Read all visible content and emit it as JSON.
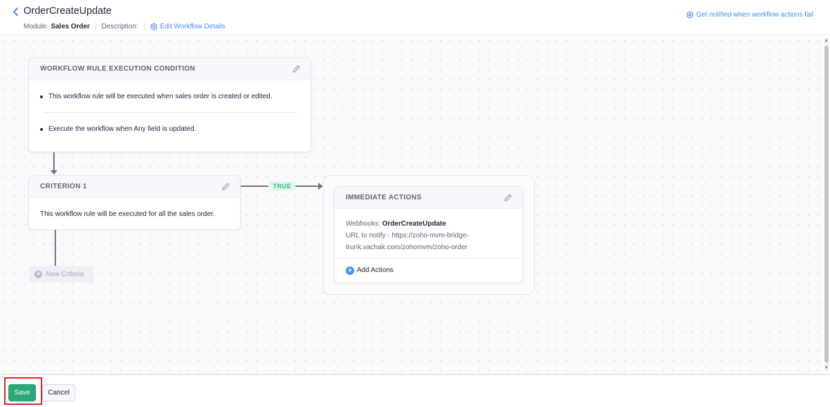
{
  "header": {
    "title": "OrderCreateUpdate",
    "module_label": "Module:",
    "module_value": "Sales Order",
    "description_label": "Description:",
    "edit_link": "Edit Workflow Details",
    "notify_link": "Get notified when workflow actions fail"
  },
  "condition_card": {
    "title": "WORKFLOW RULE EXECUTION CONDITION",
    "bullet_1": "This workflow rule will be executed when sales order is created or edited.",
    "bullet_2": "Execute the workflow when Any field is updated."
  },
  "criterion_card": {
    "title": "CRITERION 1",
    "text": "This workflow rule will be executed for all the sales order."
  },
  "branch_label": "TRUE",
  "actions_card": {
    "title": "IMMEDIATE ACTIONS",
    "webhooks_label": "Webhooks:",
    "webhook_name": "OrderCreateUpdate",
    "url_line_1": "URL to notify - https://zoho-mvm-bridge-",
    "url_line_2": "trunk.vachak.com/zohomvm/zoho-order",
    "add_actions": "Add Actions"
  },
  "new_criteria": "New Criteria",
  "footer": {
    "save": "Save",
    "cancel": "Cancel"
  },
  "colors": {
    "accent": "#408dfb",
    "save_green": "#2aa877",
    "true_green": "#2fb27d",
    "highlight_red": "#e01f26"
  },
  "icons": [
    "back-chevron-icon",
    "settings-hex-icon",
    "pencil-icon",
    "plus-circle-icon"
  ]
}
